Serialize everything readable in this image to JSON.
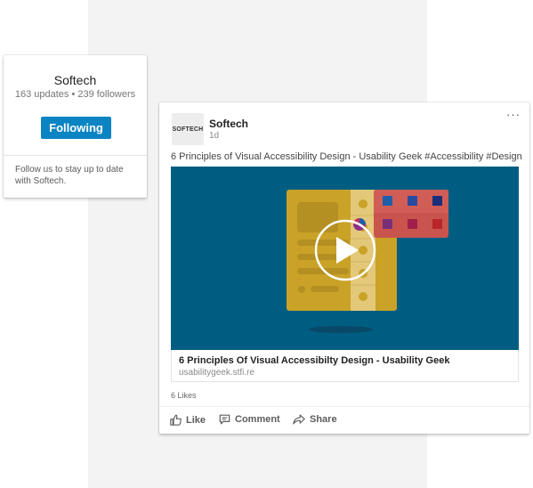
{
  "company_card": {
    "name": "Softech",
    "stats": "163 updates • 239 followers",
    "follow_button_label": "Following",
    "description": "Follow us to stay up to date with Softech."
  },
  "post": {
    "logo_text": "SOFTECH",
    "author": "Softech",
    "time": "1d",
    "menu_label": "···",
    "text": "6 Principles of Visual Accessibility Design - Usability Geek #Accessibility #Design",
    "link_title": "6 Principles Of Visual Accessibilty Design - Usability Geek",
    "link_domain": "usabilitygeek.stfi.re",
    "likes": "6 Likes",
    "actions": {
      "like": "Like",
      "comment": "Comment",
      "share": "Share"
    }
  },
  "colors": {
    "brand_blue": "#0b84c3",
    "video_background": "#005d82",
    "artwork_yellow": "#c9a227",
    "artwork_red": "#c9544e"
  },
  "icons": {
    "like": "thumbs-up-icon",
    "comment": "comment-icon",
    "share": "share-icon",
    "play": "play-icon"
  }
}
